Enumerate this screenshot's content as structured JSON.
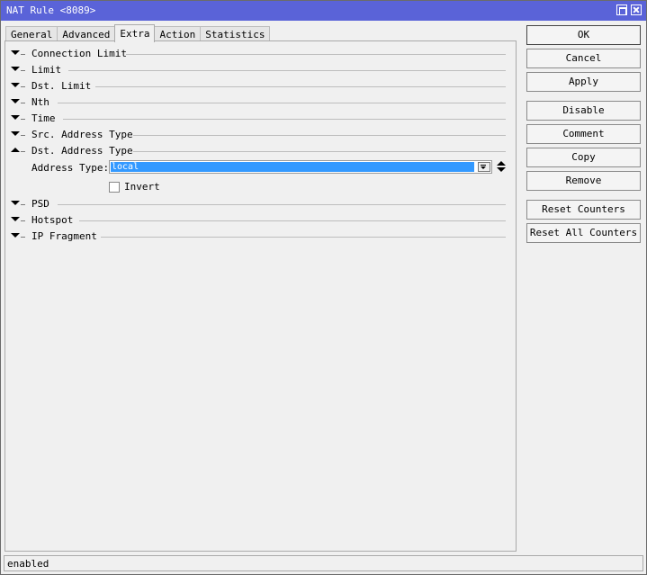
{
  "window": {
    "title": "NAT Rule <8089>"
  },
  "tabs": [
    {
      "label": "General"
    },
    {
      "label": "Advanced"
    },
    {
      "label": "Extra"
    },
    {
      "label": "Action"
    },
    {
      "label": "Statistics"
    }
  ],
  "active_tab": "Extra",
  "sections": [
    {
      "label": "Connection Limit",
      "expanded": false
    },
    {
      "label": "Limit",
      "expanded": false
    },
    {
      "label": "Dst. Limit",
      "expanded": false
    },
    {
      "label": "Nth",
      "expanded": false
    },
    {
      "label": "Time",
      "expanded": false
    },
    {
      "label": "Src. Address Type",
      "expanded": false
    },
    {
      "label": "Dst. Address Type",
      "expanded": true
    },
    {
      "label": "PSD",
      "expanded": false
    },
    {
      "label": "Hotspot",
      "expanded": false
    },
    {
      "label": "IP Fragment",
      "expanded": false
    }
  ],
  "dst_address_type": {
    "address_type_label": "Address Type:",
    "address_type_value": "local",
    "invert_label": "Invert",
    "invert_checked": false
  },
  "buttons": {
    "ok": "OK",
    "cancel": "Cancel",
    "apply": "Apply",
    "disable": "Disable",
    "comment": "Comment",
    "copy": "Copy",
    "remove": "Remove",
    "reset_counters": "Reset Counters",
    "reset_all_counters": "Reset All Counters"
  },
  "status": {
    "text": "enabled"
  },
  "colors": {
    "titlebar": "#5a63d8",
    "selection": "#3399ff",
    "background": "#f0f0f0"
  }
}
